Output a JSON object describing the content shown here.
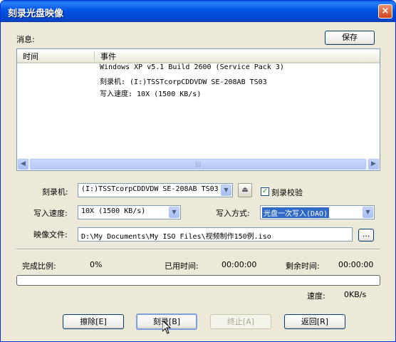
{
  "window": {
    "title": "刻录光盘映像",
    "close_icon": "×"
  },
  "messages": {
    "label": "消息:",
    "save_button": "保存",
    "columns": {
      "time": "时间",
      "event": "事件"
    },
    "rows": [
      "Windows XP v5.1 Build 2600 (Service Pack 3)",
      "刻录机: (I:)TSSTcorpCDDVDW SE-208AB TS03",
      "写入速度: 10X (1500 KB/s)"
    ],
    "scroll_left": "◀",
    "scroll_right": "▶",
    "scroll_grip": "|||"
  },
  "settings": {
    "burner_label": "刻录机:",
    "burner_value": "(I:)TSSTcorpCDDVDW SE-208AB TS03",
    "verify_label": "刻录校验",
    "verify_checked": true,
    "speed_label": "写入速度:",
    "speed_value": "10X (1500 KB/s)",
    "write_mode_label": "写入方式:",
    "write_mode_value": "光盘一次写入(DAO)",
    "image_file_label": "映像文件:",
    "image_file_value": "D:\\My Documents\\My ISO Files\\视频制作150例.iso",
    "browse_label": "..."
  },
  "progress": {
    "ratio_label": "完成比例:",
    "ratio_value": "0%",
    "elapsed_label": "已用时间:",
    "elapsed_value": "00:00:00",
    "remaining_label": "剩余时间:",
    "remaining_value": "00:00:00",
    "speed_label": "速度:",
    "speed_value": "0KB/s",
    "fraction": 0.0
  },
  "buttons": {
    "erase": "擦除[E]",
    "burn": "刻录[B]",
    "stop": "终止[A]",
    "back": "返回[R]"
  },
  "colors": {
    "titlebar": "#0053e1",
    "dialog_bg": "#ece9d8",
    "selection": "#316ac5"
  }
}
